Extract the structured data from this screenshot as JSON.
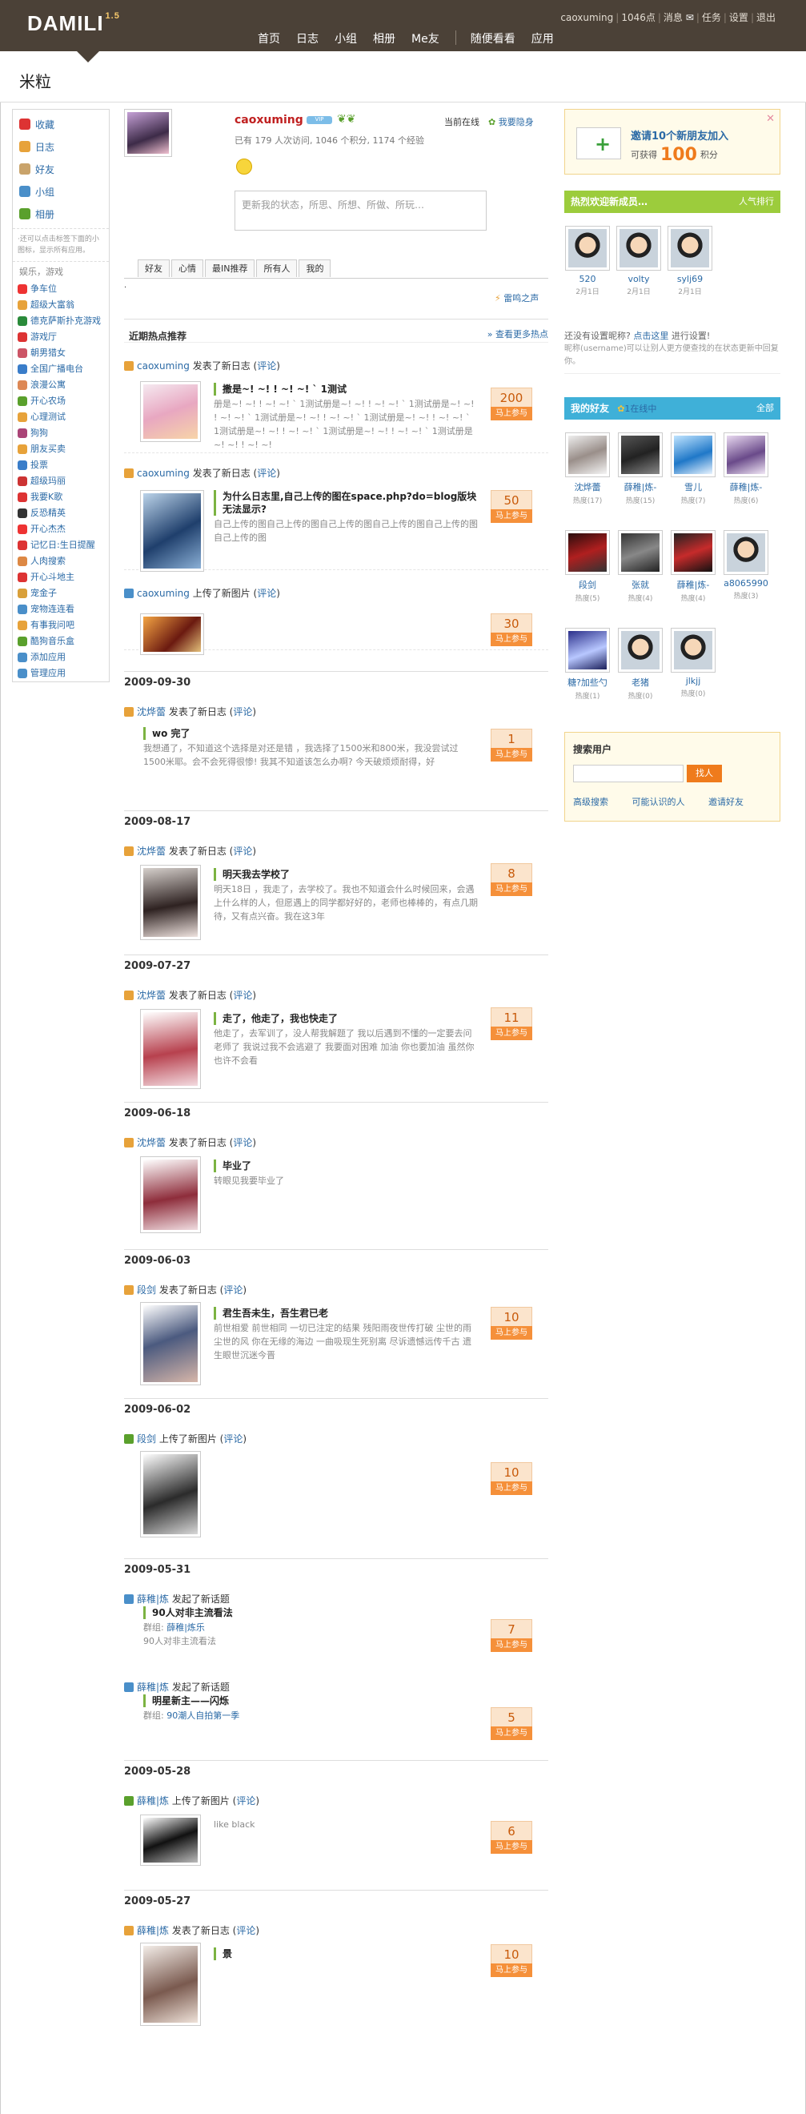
{
  "header": {
    "logo": "DAMILI",
    "version": "1.5",
    "user": "caoxuming",
    "points": "1046点",
    "messages": "消息",
    "tasks": "任务",
    "settings": "设置",
    "logout": "退出",
    "nav": [
      "首页",
      "日志",
      "小组",
      "相册",
      "Me友",
      "随便看看",
      "应用"
    ]
  },
  "page_title": "米粒",
  "left": {
    "nav": [
      {
        "label": "收藏",
        "color": "#d33"
      },
      {
        "label": "日志",
        "color": "#e7a23a"
      },
      {
        "label": "好友",
        "color": "#c9a36b"
      },
      {
        "label": "小组",
        "color": "#4a8fc9"
      },
      {
        "label": "相册",
        "color": "#5aa02c"
      }
    ],
    "note": "·还可以点击标签下面的小图标，显示所有应用。",
    "apps_head": "娱乐，游戏",
    "apps": [
      "争车位",
      "超级大富翁",
      "德克萨斯扑克游戏",
      "游戏厅",
      "朝男猎女",
      "全国广播电台",
      "浪漫公寓",
      "开心农场",
      "心理测试",
      "狗狗",
      "朋友买卖",
      "投票",
      "超级玛丽",
      "我要K歌",
      "反恐精英",
      "开心杰杰",
      "记忆日:生日提醒",
      "人肉搜索",
      "开心斗地主",
      "宠金子",
      "宠物连连看",
      "有事我问吧",
      "酷狗音乐盒",
      "添加应用",
      "管理应用"
    ]
  },
  "profile": {
    "username": "caoxuming",
    "online": "当前在线",
    "hide": "我要隐身",
    "stats": "已有 179 人次访问, 1046 个积分, 1174 个经验",
    "status_placeholder": "更新我的状态，所思、所想、所做、所玩…",
    "tabs": [
      "好友",
      "心情",
      "最IN推荐",
      "所有人",
      "我的"
    ],
    "thunder": "雷鸣之声"
  },
  "hot": {
    "title": "近期热点推荐",
    "more": "» 查看更多热点"
  },
  "feeds": [
    {
      "user": "caoxuming",
      "action": " 发表了新日志 (",
      "link": "评论",
      "close": ")",
      "title": "撒是~! ~! ! ~! ~! ` 1测试",
      "body": "册是~! ~! ! ~! ~! ` 1测试册是~! ~! ! ~! ~! ` 1测试册是~! ~! ! ~! ~! ` 1测试册是~! ~! ! ~! ~! ` 1测试册是~! ~! ! ~! ~! ` 1测试册是~! ~! ! ~! ~! ` 1测试册是~! ~! ! ~! ~! ` 1测试册是~! ~! ! ~! ~!",
      "score": "200",
      "join": "马上参与"
    },
    {
      "user": "caoxuming",
      "action": " 发表了新日志 (",
      "link": "评论",
      "close": ")",
      "title": "为什么日志里,自己上传的图在space.php?do=blog版块无法显示?",
      "body": "自己上传的图自己上传的图自己上传的图自己上传的图自己上传的图自己上传的图",
      "score": "50",
      "join": "马上参与"
    },
    {
      "user": "caoxuming",
      "action": " 上传了新图片 (",
      "link": "评论",
      "close": ")",
      "title": "",
      "body": "",
      "score": "30",
      "join": "马上参与"
    },
    {
      "date": "2009-09-30",
      "user": "沈烨蕾",
      "action": " 发表了新日志 (",
      "link": "评论",
      "close": ")",
      "title": "wo 完了",
      "body": "我想通了，不知道这个选择是对还是错 ，我选择了1500米和800米，我没尝试过 1500米耶。会不会死得很惨! 我其不知道该怎么办啊? 今天破烦烦耐得，好",
      "score": "1",
      "join": "马上参与"
    },
    {
      "date": "2009-08-17",
      "user": "沈烨蕾",
      "action": " 发表了新日志 (",
      "link": "评论",
      "close": ")",
      "title": "明天我去学校了",
      "body": "明天18日 ，我走了，去学校了。我也不知道会什么时候回来，会遇上什么样的人，但愿遇上的同学都好好的，老师也棒棒的，有点几期待，又有点兴奋。我在这3年",
      "score": "8",
      "join": "马上参与"
    },
    {
      "date": "2009-07-27",
      "user": "沈烨蕾",
      "action": " 发表了新日志 (",
      "link": "评论",
      "close": ")",
      "title": "走了，他走了，我也快走了",
      "body": "他走了，去军训了，没人帮我解题了 我以后遇到不懂的一定要去问老师了 我说过我不会逃避了 我要面对困难 加油 你也要加油 虽然你也许不会看",
      "score": "11",
      "join": "马上参与"
    },
    {
      "date": "2009-06-18",
      "user": "沈烨蕾",
      "action": " 发表了新日志 (",
      "link": "评论",
      "close": ")",
      "title": "毕业了",
      "body": "转眼见我要毕业了",
      "score": "",
      "join": ""
    },
    {
      "date": "2009-06-03",
      "user": "段剑",
      "action": " 发表了新日志 (",
      "link": "评论",
      "close": ")",
      "title": "君生吾未生，吾生君已老",
      "body": "前世相爱 前世相同 一切已注定的结果 残阳雨夜世传打破 尘世的雨 尘世的风 你在无缘的海边 一曲吸现生死别离 尽诉遗憾远传千古 遗生眼世沉迷今晋",
      "score": "10",
      "join": "马上参与"
    },
    {
      "date": "2009-06-02",
      "user": "段剑",
      "action": " 上传了新图片 (",
      "link": "评论",
      "close": ")",
      "title": "",
      "body": "",
      "score": "10",
      "join": "马上参与"
    },
    {
      "date": "2009-05-31",
      "user": "薛稚|炼",
      "action": " 发起了新话题",
      "link": "",
      "close": "",
      "title": "90人对非主流看法",
      "body": "90人对非主流看法",
      "group_label": "群组: ",
      "group": "薛稚|炼乐",
      "score": "7",
      "join": "马上参与"
    },
    {
      "user": "薛稚|炼",
      "action": " 发起了新话题",
      "link": "",
      "close": "",
      "title": "明星新主——闪烁",
      "body": "",
      "group_label": "群组: ",
      "group": "90潮人自拍第一季",
      "score": "5",
      "join": "马上参与"
    },
    {
      "date": "2009-05-28",
      "user": "薛稚|炼",
      "action": " 上传了新图片 (",
      "link": "评论",
      "close": ")",
      "title": "",
      "body": "like black",
      "score": "6",
      "join": "马上参与"
    },
    {
      "date": "2009-05-27",
      "user": "薛稚|炼",
      "action": " 发表了新日志 (",
      "link": "评论",
      "close": ")",
      "title": "景",
      "body": "",
      "score": "10",
      "join": "马上参与"
    }
  ],
  "right": {
    "invite_title": "邀请10个新朋友加入",
    "invite_sub_pre": "可获得",
    "invite_points": "100",
    "invite_sub_post": "积分",
    "new_members_title": "热烈欢迎新成员…",
    "new_members_more": "人气排行",
    "new_members": [
      {
        "name": "520",
        "date": "2月1日"
      },
      {
        "name": "volty",
        "date": "2月1日"
      },
      {
        "name": "sylj69",
        "date": "2月1日"
      }
    ],
    "tip_line1_pre": "还没有设置昵称? ",
    "tip_link": "点击这里",
    "tip_line1_post": " 进行设置!",
    "tip_line2": "昵称(username)可以让别人更方便查找的在状态更新中回复你。",
    "friends_title": "我的好友",
    "friends_link": "1在线中",
    "friends_all": "全部",
    "friends": [
      {
        "name": "沈烨蕾",
        "heat": "热度(17)"
      },
      {
        "name": "薛稚|炼-",
        "heat": "热度(15)"
      },
      {
        "name": "雪儿",
        "heat": "热度(7)"
      },
      {
        "name": "薛稚|炼-",
        "heat": "热度(6)"
      },
      {
        "name": "段剑",
        "heat": "热度(5)"
      },
      {
        "name": "张就",
        "heat": "热度(4)"
      },
      {
        "name": "薛稚|炼-",
        "heat": "热度(4)"
      },
      {
        "name": "a8065990",
        "heat": "热度(3)"
      },
      {
        "name": "糖?加些勺",
        "heat": "热度(1)"
      },
      {
        "name": "老猪",
        "heat": "热度(0)"
      },
      {
        "name": "jlkjj",
        "heat": "热度(0)"
      }
    ],
    "search_title": "搜索用户",
    "search_button": "找人",
    "search_links": [
      "高级搜索",
      "可能认识的人",
      "邀请好友"
    ]
  }
}
